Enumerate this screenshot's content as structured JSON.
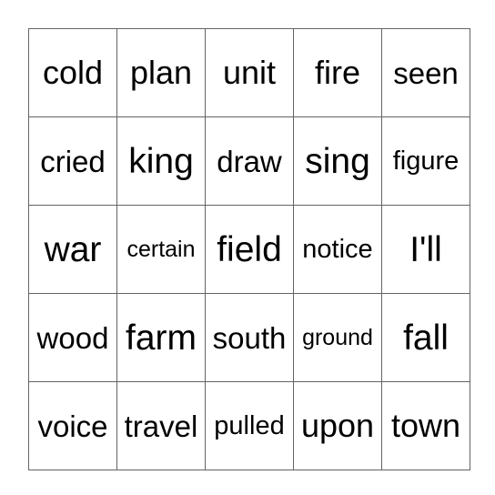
{
  "card": {
    "type": "bingo-card",
    "rows": 5,
    "columns": 5,
    "border_color": "#646464",
    "background_color": "#ffffff",
    "text_color": "#000000",
    "cells": [
      [
        {
          "label": "cold",
          "size": "lg"
        },
        {
          "label": "plan",
          "size": "lg"
        },
        {
          "label": "unit",
          "size": "lg"
        },
        {
          "label": "fire",
          "size": "lg"
        },
        {
          "label": "seen",
          "size": "md"
        }
      ],
      [
        {
          "label": "cried",
          "size": "md"
        },
        {
          "label": "king",
          "size": "xl"
        },
        {
          "label": "draw",
          "size": "md"
        },
        {
          "label": "sing",
          "size": "xl"
        },
        {
          "label": "figure",
          "size": "sm"
        }
      ],
      [
        {
          "label": "war",
          "size": "xl"
        },
        {
          "label": "certain",
          "size": "xs"
        },
        {
          "label": "field",
          "size": "xl"
        },
        {
          "label": "notice",
          "size": "sm"
        },
        {
          "label": "I'll",
          "size": "xl"
        }
      ],
      [
        {
          "label": "wood",
          "size": "md"
        },
        {
          "label": "farm",
          "size": "xl"
        },
        {
          "label": "south",
          "size": "md"
        },
        {
          "label": "ground",
          "size": "xs"
        },
        {
          "label": "fall",
          "size": "xl"
        }
      ],
      [
        {
          "label": "voice",
          "size": "md"
        },
        {
          "label": "travel",
          "size": "md"
        },
        {
          "label": "pulled",
          "size": "sm"
        },
        {
          "label": "upon",
          "size": "lg"
        },
        {
          "label": "town",
          "size": "lg"
        }
      ]
    ]
  }
}
